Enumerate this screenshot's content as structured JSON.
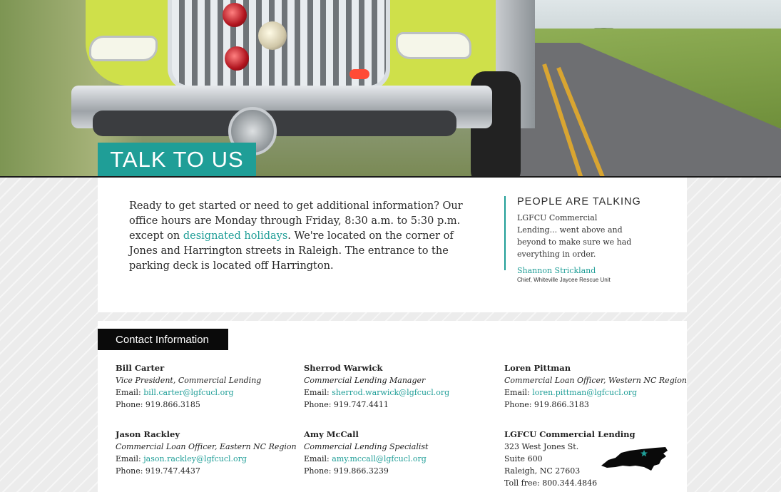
{
  "hero": {
    "title": "TALK TO US"
  },
  "intro": {
    "text_before": "Ready to get started or need to get additional information? Our office hours are Monday through Friday, 8:30 a.m. to 5:30 p.m. except on ",
    "link_text": "designated holidays",
    "text_after": ". We're located on the corner of Jones and Harrington streets in Raleigh. The entrance to the parking deck is located off Harrington."
  },
  "testimonial": {
    "heading": "PEOPLE ARE TALKING",
    "quote": "LGFCU Commercial Lending... went above and beyond to make sure we had everything in order.",
    "author": "Shannon Strickland",
    "role": "Chief, Whiteville Jaycee Rescue Unit"
  },
  "contact": {
    "heading": "Contact Information",
    "email_label": "Email: ",
    "phone_label": "Phone: ",
    "people": [
      {
        "name": "Bill Carter",
        "title": "Vice President, Commercial Lending",
        "email": "bill.carter@lgfcucl.org",
        "phone": "919.866.3185"
      },
      {
        "name": "Sherrod Warwick",
        "title": "Commercial Lending Manager",
        "email": "sherrod.warwick@lgfcucl.org",
        "phone": "919.747.4411"
      },
      {
        "name": "Loren Pittman",
        "title": "Commercial Loan Officer, Western NC Region",
        "email": "loren.pittman@lgfcucl.org",
        "phone": "919.866.3183"
      },
      {
        "name": "Jason Rackley",
        "title": "Commercial Loan Officer, Eastern NC Region",
        "email": "jason.rackley@lgfcucl.org",
        "phone": "919.747.4437"
      },
      {
        "name": "Amy McCall",
        "title": "Commercial Lending Specialist",
        "email": "amy.mccall@lgfcucl.org",
        "phone": "919.866.3239"
      }
    ],
    "office": {
      "name": "LGFCU Commercial Lending",
      "street": "323 West Jones St.",
      "suite": "Suite 600",
      "city": "Raleigh, NC 27603",
      "toll_free": "Toll free: 800.344.4846"
    }
  },
  "colors": {
    "accent": "#1f9e97",
    "dark": "#0a0a0a"
  },
  "icons": {
    "map": "north-carolina-map-icon",
    "star": "star-icon"
  }
}
